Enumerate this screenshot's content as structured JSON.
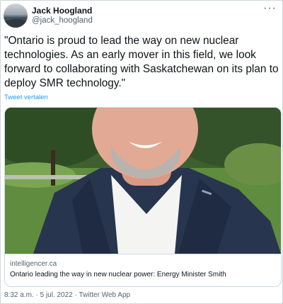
{
  "tweet": {
    "author": {
      "display_name": "Jack Hoogland",
      "handle": "@jack_hoogland",
      "avatar_icon": "avatar-image"
    },
    "more_icon": "more-horizontal-icon",
    "more_glyph": "···",
    "text": "\"Ontario is proud to lead the way on new nuclear technologies. As an early mover in this field, we look forward to collaborating with Saskatchewan on its plan to deploy SMR technology.\"",
    "translate_label": "Tweet vertalen",
    "link_card": {
      "domain": "intelligencer.ca",
      "title": "Ontario leading the way in new nuclear power: Energy Minister Smith"
    },
    "footer": {
      "time": "8:32 a.m.",
      "separator_1": " · ",
      "date": "5 jul. 2022",
      "separator_2": " · ",
      "source": "Twitter Web App"
    }
  },
  "colors": {
    "text": "#0f1419",
    "secondary": "#536471",
    "link": "#1d9bf0",
    "border": "#cfd9de"
  }
}
